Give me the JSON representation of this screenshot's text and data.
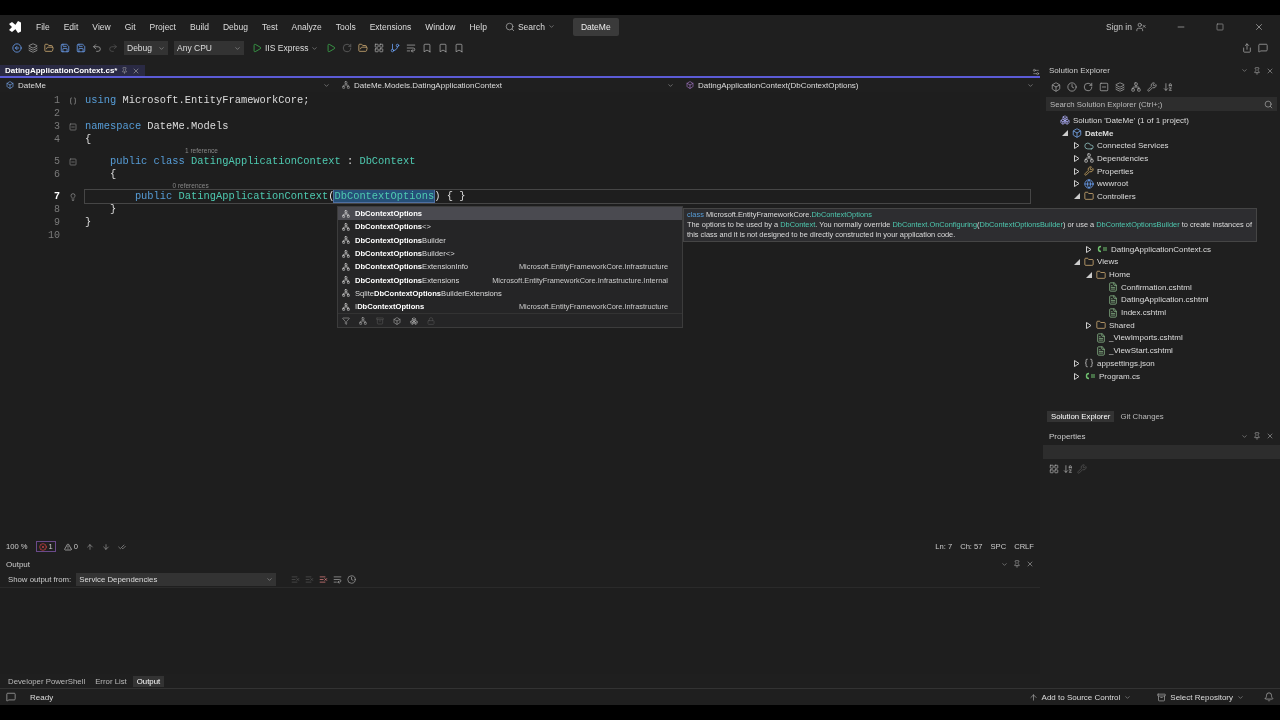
{
  "menu": {
    "items": [
      "File",
      "Edit",
      "View",
      "Git",
      "Project",
      "Build",
      "Debug",
      "Test",
      "Analyze",
      "Tools",
      "Extensions",
      "Window",
      "Help"
    ],
    "search": "Search",
    "solution_badge": "DateMe",
    "sign_in": "Sign in"
  },
  "toolbar": {
    "configuration": "Debug",
    "platform": "Any CPU",
    "run_target": "IIS Express"
  },
  "document_tabs": [
    {
      "label": "DatingApplicationContext.cs*",
      "selected": true
    }
  ],
  "navigation": {
    "project": "DateMe",
    "type": "DateMe.Models.DatingApplicationContext",
    "member": "DatingApplicationContext(DbContextOptions)"
  },
  "code_lines": [
    {
      "number": "1",
      "current": false,
      "tokens": [
        {
          "kind": "keyword",
          "text": "using"
        },
        {
          "kind": "plain",
          "text": " Microsoft.EntityFrameworkCore;"
        }
      ]
    },
    {
      "number": "2",
      "current": false
    },
    {
      "number": "3",
      "current": false,
      "collapsible": true,
      "tokens": [
        {
          "kind": "keyword",
          "text": "namespace"
        },
        {
          "kind": "plain",
          "text": " DateMe.Models"
        }
      ]
    },
    {
      "number": "4",
      "current": false,
      "tokens": [
        {
          "kind": "plain",
          "text": "{"
        }
      ]
    },
    {
      "number": "5",
      "current": false,
      "collapsible": true,
      "codelens": "1 reference",
      "tokens": [
        {
          "kind": "keyword",
          "text": "    public class"
        },
        {
          "kind": "type",
          "text": " DatingApplicationContext"
        },
        {
          "kind": "plain",
          "text": " : "
        },
        {
          "kind": "type",
          "text": "DbContext"
        }
      ]
    },
    {
      "number": "6",
      "current": false,
      "tokens": [
        {
          "kind": "plain",
          "text": "    {"
        }
      ]
    },
    {
      "number": "7",
      "current": true,
      "codelens": "0 references",
      "tokens": [
        {
          "kind": "keyword",
          "text": "        public"
        },
        {
          "kind": "type",
          "text": " DatingApplicationContext"
        },
        {
          "kind": "plain",
          "text": "("
        },
        {
          "kind": "match",
          "text": "DbContextOptions"
        },
        {
          "kind": "plain",
          "text": ") { }"
        }
      ]
    },
    {
      "number": "8",
      "current": false,
      "tokens": [
        {
          "kind": "plain",
          "text": "    }"
        }
      ]
    },
    {
      "number": "9",
      "current": false,
      "tokens": [
        {
          "kind": "plain",
          "text": "}"
        }
      ]
    },
    {
      "number": "10",
      "current": false
    }
  ],
  "completion": {
    "items": [
      {
        "text": "**DbContextOptions**",
        "selected": true
      },
      {
        "text": "**DbContextOptions**<>",
        "selected": false
      },
      {
        "text": "**DbContextOptions**Builder",
        "selected": false
      },
      {
        "text": "**DbContextOptions**Builder<>",
        "selected": false
      },
      {
        "text": "**DbContextOptions**ExtensionInfo",
        "namespace": "Microsoft.EntityFrameworkCore.Infrastructure",
        "selected": false
      },
      {
        "text": "**DbContextOptions**Extensions",
        "namespace": "Microsoft.EntityFrameworkCore.Infrastructure.Internal",
        "selected": false
      },
      {
        "text": "Sqlite**DbContextOptions**BuilderExtensions",
        "selected": false
      },
      {
        "text": "I**DbContextOptions**",
        "namespace": "Microsoft.EntityFrameworkCore.Infrastructure",
        "selected": false
      }
    ]
  },
  "quick_info": {
    "kind_label": "class",
    "namespace": "Microsoft.EntityFrameworkCore.",
    "type_name": "DbContextOptions",
    "description": [
      {
        "kind": "text",
        "text": "The options to be used by a "
      },
      {
        "kind": "type",
        "text": "DbContext"
      },
      {
        "kind": "text",
        "text": ". You normally override "
      },
      {
        "kind": "type",
        "text": "DbContext.OnConfiguring"
      },
      {
        "kind": "text",
        "text": "("
      },
      {
        "kind": "type",
        "text": "DbContextOptionsBuilder"
      },
      {
        "kind": "text",
        "text": ") or use a "
      },
      {
        "kind": "type",
        "text": "DbContextOptionsBuilder"
      },
      {
        "kind": "text",
        "text": " to create instances of this class and it is not designed to be directly constructed in your application code."
      }
    ]
  },
  "editor_status": {
    "zoom": "100 %",
    "errors": "1",
    "warnings": "0",
    "line": "Ln: 7",
    "column": "Ch: 57",
    "indent": "SPC",
    "line_ending": "CRLF"
  },
  "output": {
    "title": "Output",
    "source_label": "Show output from:",
    "source": "Service Dependencies"
  },
  "bottom_tabs": [
    {
      "label": "Developer PowerShell",
      "selected": false
    },
    {
      "label": "Error List",
      "selected": false
    },
    {
      "label": "Output",
      "selected": true
    }
  ],
  "solution_explorer": {
    "title": "Solution Explorer",
    "search_placeholder": "Search Solution Explorer (Ctrl+;)",
    "tree": [
      {
        "label": "Solution 'DateMe' (1 of 1 project)",
        "kind": "solution",
        "children": [
          {
            "label": "DateMe",
            "kind": "project",
            "expanded": true,
            "children": [
              {
                "label": "Connected Services",
                "kind": "service",
                "expanded": false
              },
              {
                "label": "Dependencies",
                "kind": "dependencies",
                "expanded": false
              },
              {
                "label": "Properties",
                "kind": "properties",
                "expanded": false
              },
              {
                "label": "wwwroot",
                "kind": "webroot",
                "expanded": false
              },
              {
                "label": "Controllers",
                "kind": "folder",
                "expanded": true,
                "children": [
                  {
                    "label": "DatingApplicationContext.cs",
                    "kind": "csharp",
                    "expanded": false
                  }
                ]
              },
              {
                "label": "Views",
                "kind": "folder",
                "expanded": true,
                "children": [
                  {
                    "label": "Home",
                    "kind": "folder",
                    "expanded": true,
                    "children": [
                      {
                        "label": "Confirmation.cshtml",
                        "kind": "page"
                      },
                      {
                        "label": "DatingApplication.cshtml",
                        "kind": "page"
                      },
                      {
                        "label": "Index.cshtml",
                        "kind": "page"
                      }
                    ]
                  },
                  {
                    "label": "Shared",
                    "kind": "folder",
                    "expanded": false
                  },
                  {
                    "label": "_ViewImports.cshtml",
                    "kind": "page"
                  },
                  {
                    "label": "_ViewStart.cshtml",
                    "kind": "page"
                  }
                ]
              },
              {
                "label": "appsettings.json",
                "kind": "json",
                "expanded": false
              },
              {
                "label": "Program.cs",
                "kind": "csharp",
                "expanded": false
              }
            ]
          }
        ]
      }
    ]
  },
  "panel_tabs": [
    {
      "label": "Solution Explorer",
      "selected": true
    },
    {
      "label": "Git Changes",
      "selected": false
    }
  ],
  "properties": {
    "title": "Properties"
  },
  "status_bar": {
    "state": "Ready",
    "source_control": "Add to Source Control",
    "repository": "Select Repository"
  }
}
